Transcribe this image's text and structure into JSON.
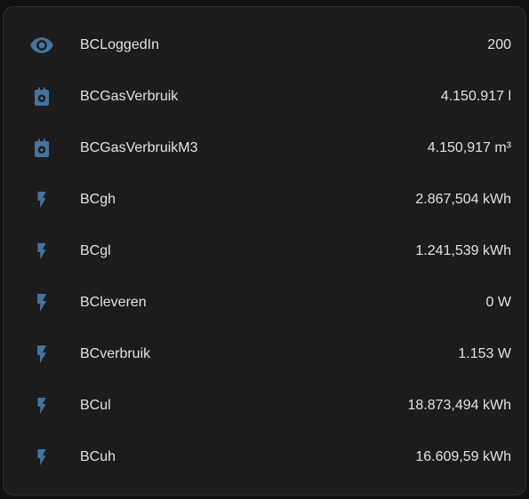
{
  "theme": {
    "icon_color": "#44739e",
    "text_color": "#e1e1e1",
    "card_background": "#1c1c1c"
  },
  "entities": [
    {
      "icon": "eye-icon",
      "name": "BCLoggedIn",
      "value": "200"
    },
    {
      "icon": "gas-meter-icon",
      "name": "BCGasVerbruik",
      "value": "4.150.917 l"
    },
    {
      "icon": "gas-meter-icon",
      "name": "BCGasVerbruikM3",
      "value": "4.150,917 m³"
    },
    {
      "icon": "flash-outline-icon",
      "name": "BCgh",
      "value": "2.867,504 kWh"
    },
    {
      "icon": "flash-outline-icon",
      "name": "BCgl",
      "value": "1.241,539 kWh"
    },
    {
      "icon": "flash-icon",
      "name": "BCleveren",
      "value": "0 W"
    },
    {
      "icon": "flash-icon",
      "name": "BCverbruik",
      "value": "1.153 W"
    },
    {
      "icon": "flash-outline-icon",
      "name": "BCul",
      "value": "18.873,494 kWh"
    },
    {
      "icon": "flash-outline-icon",
      "name": "BCuh",
      "value": "16.609,59 kWh"
    }
  ]
}
